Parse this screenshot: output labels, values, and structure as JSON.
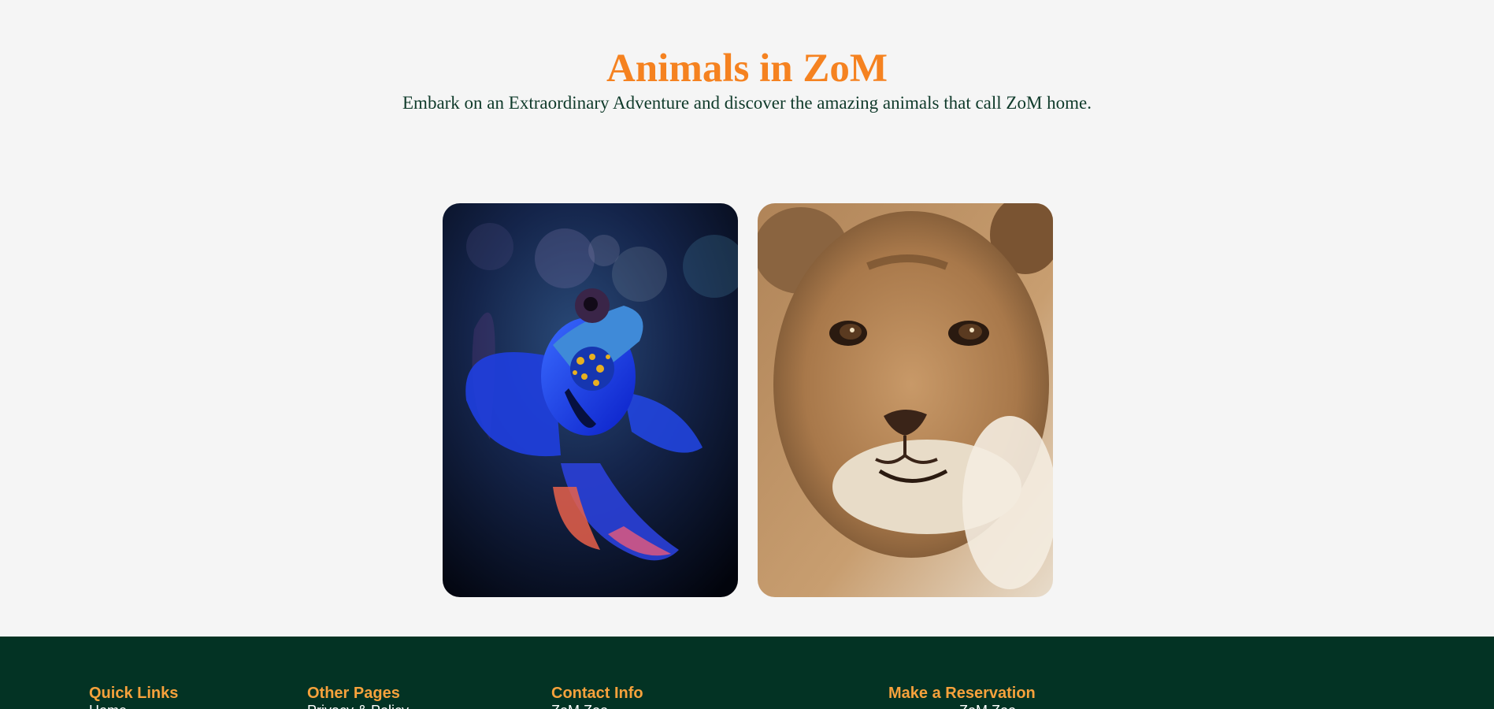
{
  "hero": {
    "title": "Animals in ZoM",
    "subtitle": "Embark on an Extraordinary Adventure and discover the amazing animals that call ZoM home."
  },
  "gallery": {
    "cards": [
      {
        "name": "fish-photo"
      },
      {
        "name": "lion-cub-photo"
      }
    ]
  },
  "footer": {
    "columns": [
      {
        "heading": "Quick Links",
        "first_item": "Home"
      },
      {
        "heading": "Other Pages",
        "first_item": "Privacy & Policy"
      },
      {
        "heading": "Contact Info",
        "first_item": "ZoM Zoo"
      },
      {
        "heading": "Make a Reservation",
        "first_item": "ZoM Zoo"
      }
    ]
  },
  "colors": {
    "page_background": "#f5f5f5",
    "title_orange": "#f58220",
    "subtitle_green": "#0f3a2a",
    "footer_background": "#033324",
    "footer_heading": "#f7a23c"
  }
}
